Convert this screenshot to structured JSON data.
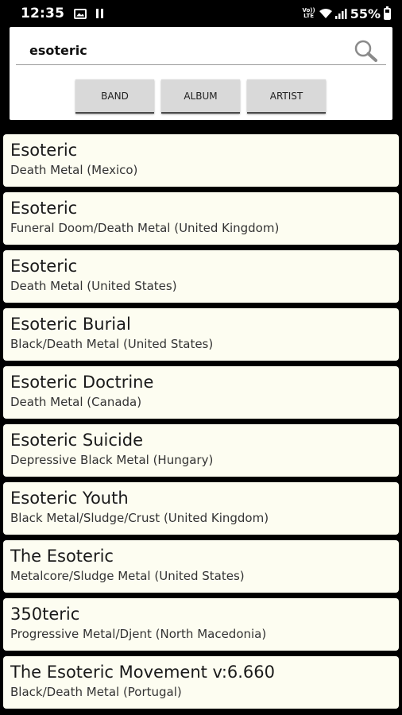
{
  "status_bar": {
    "time": "12:35",
    "network_badge_top": "Vo))",
    "network_badge_bottom": "LTE",
    "battery": "55%"
  },
  "search": {
    "value": "esoteric",
    "placeholder": "",
    "icon": "search-icon"
  },
  "filter_buttons": [
    "BAND",
    "ALBUM",
    "ARTIST"
  ],
  "results": [
    {
      "name": "Esoteric",
      "info": "Death Metal (Mexico)"
    },
    {
      "name": "Esoteric",
      "info": "Funeral Doom/Death Metal (United Kingdom)"
    },
    {
      "name": "Esoteric",
      "info": "Death Metal (United States)"
    },
    {
      "name": "Esoteric Burial",
      "info": "Black/Death Metal (United States)"
    },
    {
      "name": "Esoteric Doctrine",
      "info": "Death Metal (Canada)"
    },
    {
      "name": "Esoteric Suicide",
      "info": "Depressive Black Metal (Hungary)"
    },
    {
      "name": "Esoteric Youth",
      "info": "Black Metal/Sludge/Crust (United Kingdom)"
    },
    {
      "name": "The Esoteric",
      "info": "Metalcore/Sludge Metal (United States)"
    },
    {
      "name": "350teric",
      "info": "Progressive Metal/Djent (North Macedonia)"
    },
    {
      "name": "The Esoteric Movement v:6.660",
      "info": "Black/Death Metal (Portugal)"
    }
  ],
  "colors": {
    "background": "#000000",
    "card": "#fdfdf1",
    "button": "#d9d9d9"
  }
}
